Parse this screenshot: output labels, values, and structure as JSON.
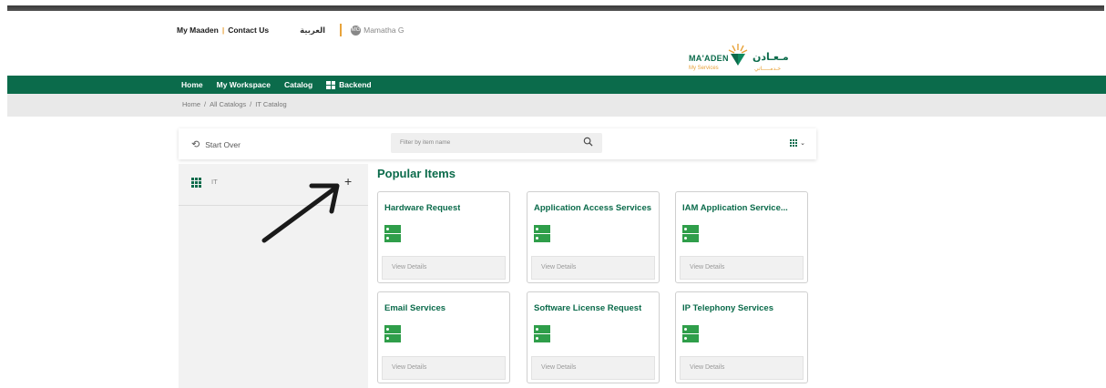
{
  "top_links": {
    "my_maaden": "My Maaden",
    "separator": "|",
    "contact_us": "Contact Us",
    "arabic": "العربية",
    "user_name": "Mamatha G",
    "user_initials": "MG"
  },
  "logo": {
    "brand_en": "MA'ADEN",
    "brand_ar": "مـعـادن",
    "subtitle_en": "My Services",
    "subtitle_ar": "خـدمـــــاتي"
  },
  "nav": {
    "home": "Home",
    "my_workspace": "My Workspace",
    "catalog": "Catalog",
    "backend": "Backend"
  },
  "breadcrumb": {
    "items": [
      "Home",
      "All Catalogs",
      "IT Catalog"
    ],
    "separator": "/"
  },
  "toolbar": {
    "start_over": "Start Over",
    "filter_placeholder": "Filter by item name"
  },
  "sidebar": {
    "category_label": "IT",
    "add_symbol": "+"
  },
  "main": {
    "heading": "Popular Items",
    "cards": [
      {
        "title": "Hardware Request",
        "action": "View Details"
      },
      {
        "title": "Application Access Services",
        "action": "View Details"
      },
      {
        "title": "IAM Application Service...",
        "action": "View Details"
      },
      {
        "title": "Email Services",
        "action": "View Details"
      },
      {
        "title": "Software License Request",
        "action": "View Details"
      },
      {
        "title": "IP Telephony Services",
        "action": "View Details"
      }
    ]
  },
  "colors": {
    "brand_green": "#0b6b4b",
    "accent_orange": "#e8a33b",
    "icon_green": "#2f9e4a"
  }
}
